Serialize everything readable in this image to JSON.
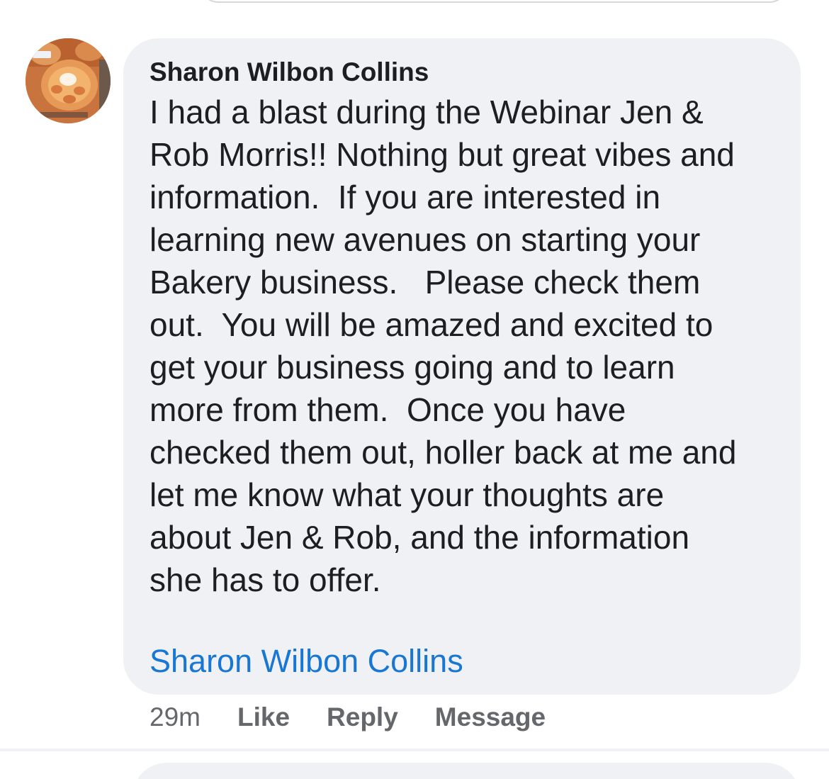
{
  "comment": {
    "author": "Sharon Wilbon Collins",
    "text_lines": [
      "I had a blast during the Webinar Jen &",
      "Rob Morris!! Nothing but great vibes and",
      "information.  If you are interested in",
      "learning new avenues on starting your",
      "Bakery business.   Please check them",
      "out.  You will be amazed and excited to",
      "get your business going and to learn",
      "more from them.  Once you have",
      "checked them out, holler back at me and",
      "let me know what your thoughts are",
      "about Jen & Rob, and the information",
      "she has to offer."
    ],
    "tagged_name": "Sharon Wilbon Collins",
    "timestamp": "29m",
    "actions": {
      "like": "Like",
      "reply": "Reply",
      "message": "Message"
    }
  },
  "colors": {
    "bubble_bg": "#f0f1f4",
    "text": "#1c1e21",
    "link": "#1877d2",
    "meta": "#65676b"
  },
  "icons": {
    "avatar": "profile-photo-pastry"
  }
}
